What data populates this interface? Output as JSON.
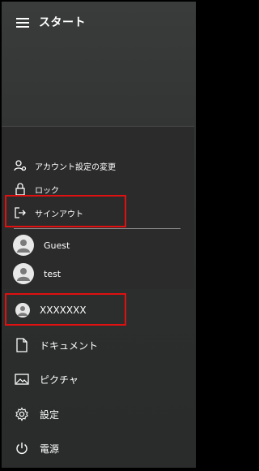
{
  "header": {
    "title": "スタート",
    "menu_icon": "hamburger-icon"
  },
  "account_menu": {
    "items": [
      {
        "label": "アカウント設定の変更",
        "icon": "account-settings-icon"
      },
      {
        "label": "ロック",
        "icon": "lock-icon"
      },
      {
        "label": "サインアウト",
        "icon": "sign-out-icon"
      }
    ],
    "users": [
      {
        "label": "Guest",
        "icon": "user-avatar-icon"
      },
      {
        "label": "test",
        "icon": "user-avatar-icon"
      }
    ]
  },
  "nav": {
    "current_user": "XXXXXXX",
    "documents": "ドキュメント",
    "pictures": "ピクチャ",
    "settings": "設定",
    "power": "電源"
  },
  "colors": {
    "highlight": "#e01010",
    "background": "#2e3030"
  }
}
